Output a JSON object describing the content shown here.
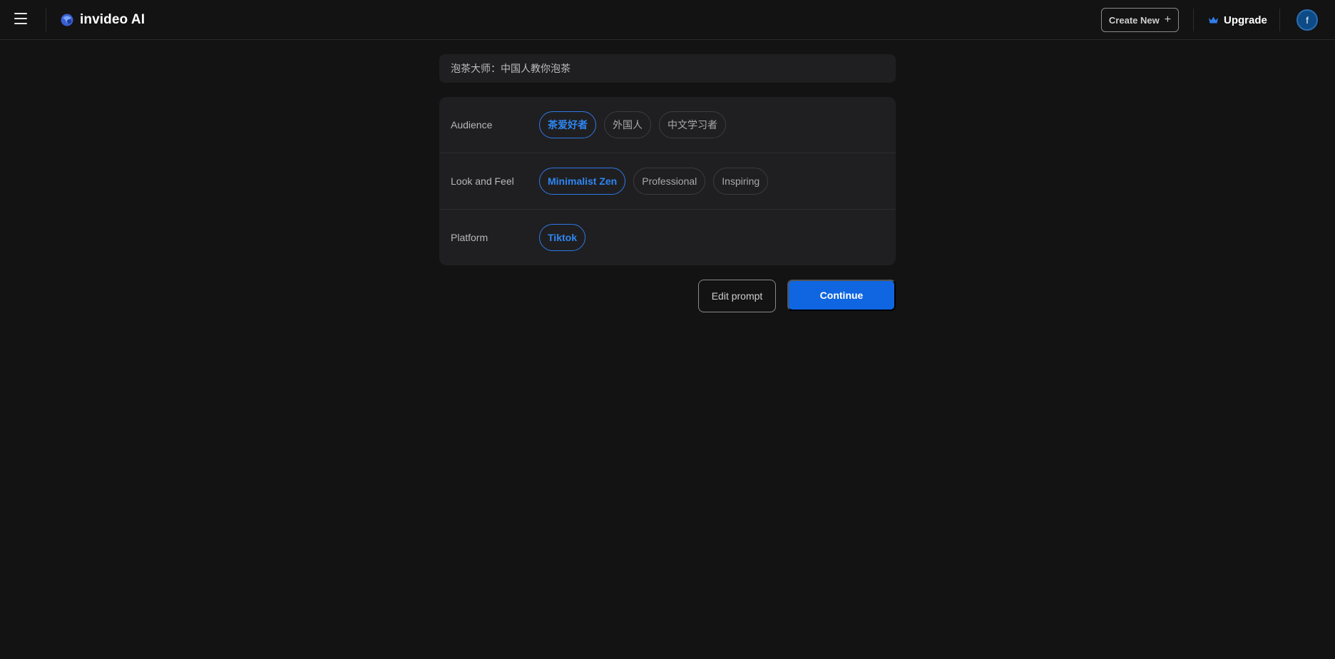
{
  "header": {
    "brand_name": "invideo AI",
    "create_new_label": "Create New",
    "upgrade_label": "Upgrade",
    "avatar_initial": "f",
    "icons": [
      "menu-icon",
      "invideo-logo-icon",
      "plus-icon",
      "crown-icon"
    ]
  },
  "prompt": {
    "text": "泡茶大师：中国人教你泡茶"
  },
  "options": {
    "audience": {
      "label": "Audience",
      "chips": [
        {
          "label": "茶爱好者",
          "selected": true
        },
        {
          "label": "外国人",
          "selected": false
        },
        {
          "label": "中文学习者",
          "selected": false
        }
      ]
    },
    "look_and_feel": {
      "label": "Look and Feel",
      "chips": [
        {
          "label": "Minimalist Zen",
          "selected": true
        },
        {
          "label": "Professional",
          "selected": false
        },
        {
          "label": "Inspiring",
          "selected": false
        }
      ]
    },
    "platform": {
      "label": "Platform",
      "chips": [
        {
          "label": "Tiktok",
          "selected": true
        }
      ]
    }
  },
  "actions": {
    "edit_prompt_label": "Edit prompt",
    "continue_label": "Continue"
  },
  "colors": {
    "background": "#131313",
    "card": "#1f1f21",
    "accent": "#0f66e0",
    "selected_chip": "#2f86f2"
  }
}
